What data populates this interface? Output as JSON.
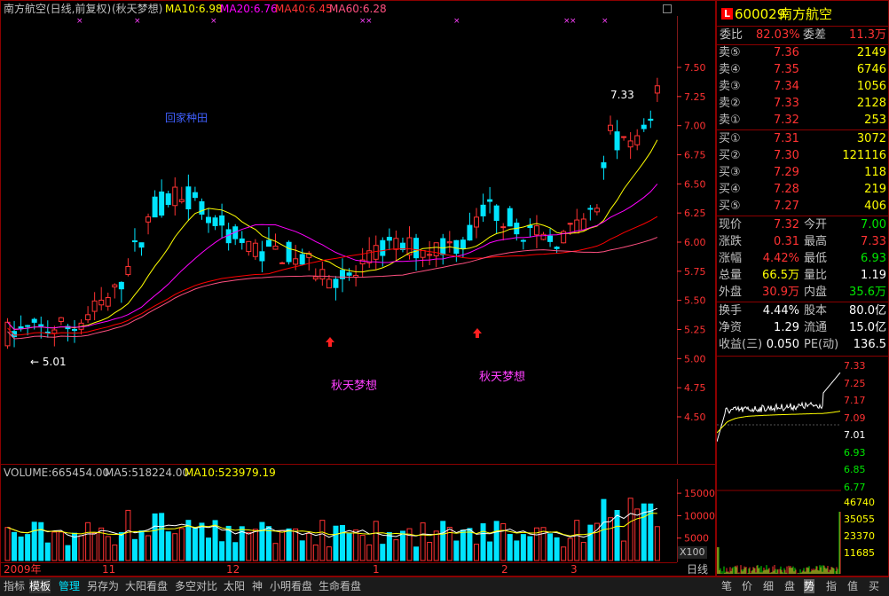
{
  "header": {
    "title": "南方航空(日线,前复权)",
    "template": "(秋天梦想)",
    "ma10": "MA10:6.98",
    "ma20": "MA20:6.76",
    "ma40": "MA40:6.45",
    "ma60": "MA60:6.28"
  },
  "chart_labels": {
    "high_label": "7.33",
    "low_label": "← 5.01",
    "annot_blue": "回家种田",
    "annot_magenta_1": "秋天梦想",
    "annot_magenta_2": "秋天梦想"
  },
  "price_axis": [
    "7.50",
    "7.25",
    "7.00",
    "6.75",
    "6.50",
    "6.25",
    "6.00",
    "5.75",
    "5.50",
    "5.25",
    "5.00",
    "4.75",
    "4.50"
  ],
  "volume_header": {
    "volume": "VOLUME:665454.00",
    "ma5": "MA5:518224.00",
    "ma10": "MA10:523979.19"
  },
  "volume_axis": [
    "15000",
    "10000",
    "5000"
  ],
  "volume_unit": "X100",
  "date_axis": [
    "2009年",
    "11",
    "12",
    "1",
    "2",
    "3"
  ],
  "stock": {
    "code": "600029",
    "name": "南方航空",
    "logo": "L"
  },
  "quote": {
    "weibi_label": "委比",
    "weibi": "82.03%",
    "weicha_label": "委差",
    "weicha": "11.3万",
    "sell": [
      {
        "label": "卖⑤",
        "price": "7.36",
        "vol": "2149"
      },
      {
        "label": "卖④",
        "price": "7.35",
        "vol": "6746"
      },
      {
        "label": "卖③",
        "price": "7.34",
        "vol": "1056"
      },
      {
        "label": "卖②",
        "price": "7.33",
        "vol": "2128"
      },
      {
        "label": "卖①",
        "price": "7.32",
        "vol": "253"
      }
    ],
    "buy": [
      {
        "label": "买①",
        "price": "7.31",
        "vol": "3072"
      },
      {
        "label": "买②",
        "price": "7.30",
        "vol": "121116"
      },
      {
        "label": "买③",
        "price": "7.29",
        "vol": "118"
      },
      {
        "label": "买④",
        "price": "7.28",
        "vol": "219"
      },
      {
        "label": "买⑤",
        "price": "7.27",
        "vol": "406"
      }
    ],
    "stats": [
      {
        "l1": "现价",
        "v1": "7.32",
        "l2": "今开",
        "v2": "7.00"
      },
      {
        "l1": "涨跌",
        "v1": "0.31",
        "l2": "最高",
        "v2": "7.33"
      },
      {
        "l1": "涨幅",
        "v1": "4.42%",
        "l2": "最低",
        "v2": "6.93"
      },
      {
        "l1": "总量",
        "v1": "66.5万",
        "l2": "量比",
        "v2": "1.19"
      },
      {
        "l1": "外盘",
        "v1": "30.9万",
        "l2": "内盘",
        "v2": "35.6万"
      }
    ],
    "extra": [
      {
        "l1": "换手",
        "v1": "4.44%",
        "l2": "股本",
        "v2": "80.0亿"
      },
      {
        "l1": "净资",
        "v1": "1.29",
        "l2": "流通",
        "v2": "15.0亿"
      },
      {
        "l1": "收益(三)",
        "v1": "0.050",
        "l2": "PE(动)",
        "v2": "136.5"
      }
    ]
  },
  "mini_price_axis": [
    "7.33",
    "7.25",
    "7.17",
    "7.09",
    "7.01",
    "6.93",
    "6.85",
    "6.77"
  ],
  "mini_volume_axis": [
    "46740",
    "35055",
    "23370",
    "11685"
  ],
  "bottom_tabs": [
    "指标",
    "模板",
    "管理",
    "另存为",
    "大阳看盘",
    "多空对比",
    "太阳",
    "神",
    "小明看盘",
    "生命看盘"
  ],
  "period_label": "日线",
  "right_tabs": [
    "笔",
    "价",
    "细",
    "盘",
    "势",
    "指",
    "值",
    "买"
  ],
  "colors": {
    "up": "#ff3232",
    "down": "#00e4ff",
    "ma5": "#ffffff",
    "ma10": "#ffff00",
    "ma20": "#ff00ff",
    "ma40": "#ff0000",
    "ma60": "#ff5080",
    "axis": "#ff3232",
    "up_text": "#ff3232",
    "down_text": "#00e600"
  }
}
